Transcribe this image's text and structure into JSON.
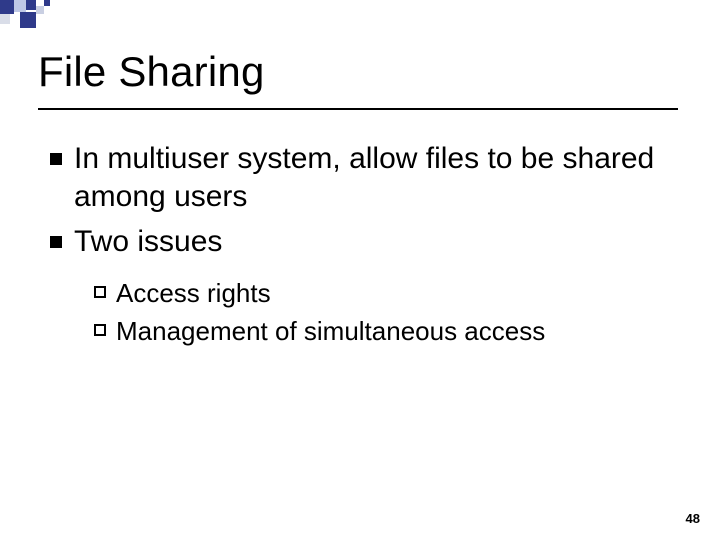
{
  "title": "File Sharing",
  "bullets": [
    {
      "text": "In multiuser system, allow files to be shared among users"
    },
    {
      "text": "Two issues"
    }
  ],
  "subbullets": [
    {
      "text": "Access rights"
    },
    {
      "text": "Management of simultaneous access"
    }
  ],
  "page_number": "48"
}
